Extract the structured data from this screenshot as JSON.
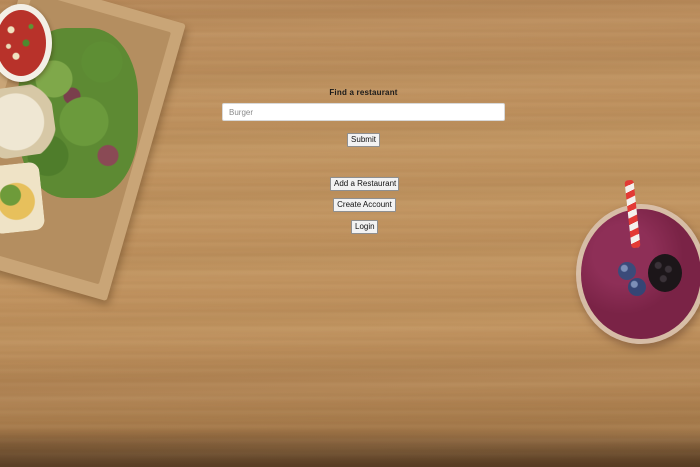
{
  "search": {
    "heading": "Find a restaurant",
    "placeholder": "Burger",
    "value": ""
  },
  "actions": {
    "submit_label": "Submit",
    "add_restaurant_label": "Add a Restaurant",
    "create_account_label": "Create Account",
    "login_label": "Login"
  },
  "background": {
    "theme": "wooden-table",
    "decorations": [
      "food-box-image",
      "smoothie-image"
    ]
  }
}
